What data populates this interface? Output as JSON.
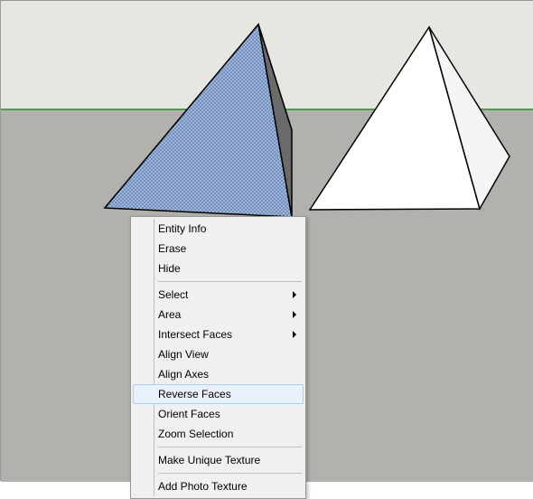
{
  "viewport": {
    "sky_color": "#e6e7e1",
    "ground_color": "#b1b1ad",
    "horizon_line_color": "#4caf50"
  },
  "shapes": {
    "left_tetrahedron": {
      "selected_face_pattern": "dotted-blue",
      "selected_color": "#97aed3"
    },
    "right_tetrahedron": {
      "face_color": "#ffffff"
    }
  },
  "context_menu": {
    "items": [
      {
        "label": "Entity Info",
        "submenu": false
      },
      {
        "label": "Erase",
        "submenu": false
      },
      {
        "label": "Hide",
        "submenu": false
      },
      {
        "type": "separator"
      },
      {
        "label": "Select",
        "submenu": true
      },
      {
        "label": "Area",
        "submenu": true
      },
      {
        "label": "Intersect Faces",
        "submenu": true
      },
      {
        "label": "Align View",
        "submenu": false
      },
      {
        "label": "Align Axes",
        "submenu": false
      },
      {
        "label": "Reverse Faces",
        "submenu": false,
        "highlighted": true
      },
      {
        "label": "Orient Faces",
        "submenu": false
      },
      {
        "label": "Zoom Selection",
        "submenu": false
      },
      {
        "type": "separator"
      },
      {
        "label": "Make Unique Texture",
        "submenu": false
      },
      {
        "type": "separator"
      },
      {
        "label": "Add Photo Texture",
        "submenu": false
      }
    ]
  }
}
